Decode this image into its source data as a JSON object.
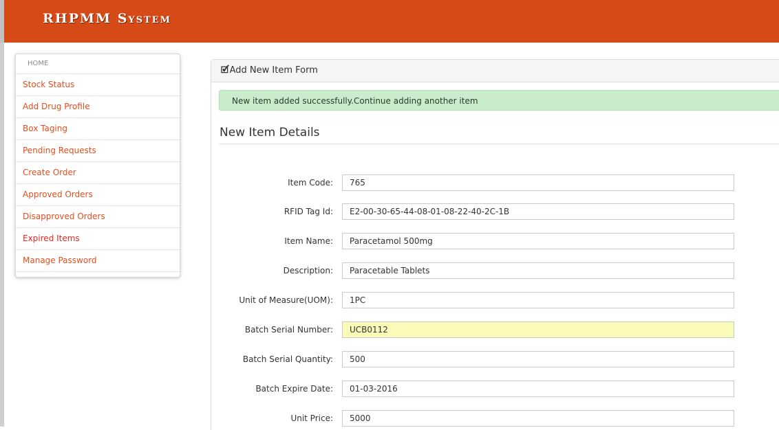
{
  "header": {
    "brand": "RHPMM System"
  },
  "sidebar": {
    "home": "HOME",
    "items": [
      {
        "label": "Stock Status"
      },
      {
        "label": "Add Drug Profile"
      },
      {
        "label": "Box Taging"
      },
      {
        "label": "Pending Requests"
      },
      {
        "label": "Create Order"
      },
      {
        "label": "Approved Orders"
      },
      {
        "label": "Disapproved Orders"
      },
      {
        "label": "Expired Items"
      },
      {
        "label": "Manage Password"
      }
    ]
  },
  "panel": {
    "title": "Add New Item Form",
    "alert": "New item added successfully.Continue adding another item",
    "section_title": "New Item Details",
    "fields": [
      {
        "label": "Item Code:",
        "value": "765"
      },
      {
        "label": "RFID Tag Id:",
        "value": "E2-00-30-65-44-08-01-08-22-40-2C-1B"
      },
      {
        "label": "Item Name:",
        "value": "Paracetamol 500mg"
      },
      {
        "label": "Description:",
        "value": "Paracetable Tablets"
      },
      {
        "label": "Unit of Measure(UOM):",
        "value": "1PC"
      },
      {
        "label": "Batch Serial Number:",
        "value": "UCB0112"
      },
      {
        "label": "Batch Serial Quantity:",
        "value": "500"
      },
      {
        "label": "Batch Expire Date:",
        "value": "01-03-2016"
      },
      {
        "label": "Unit Price:",
        "value": "5000"
      }
    ]
  },
  "colors": {
    "header_bg": "#d64a18",
    "link": "#e04e1c",
    "alert_bg": "#c9eccb",
    "highlight_field": "#fafab9"
  }
}
